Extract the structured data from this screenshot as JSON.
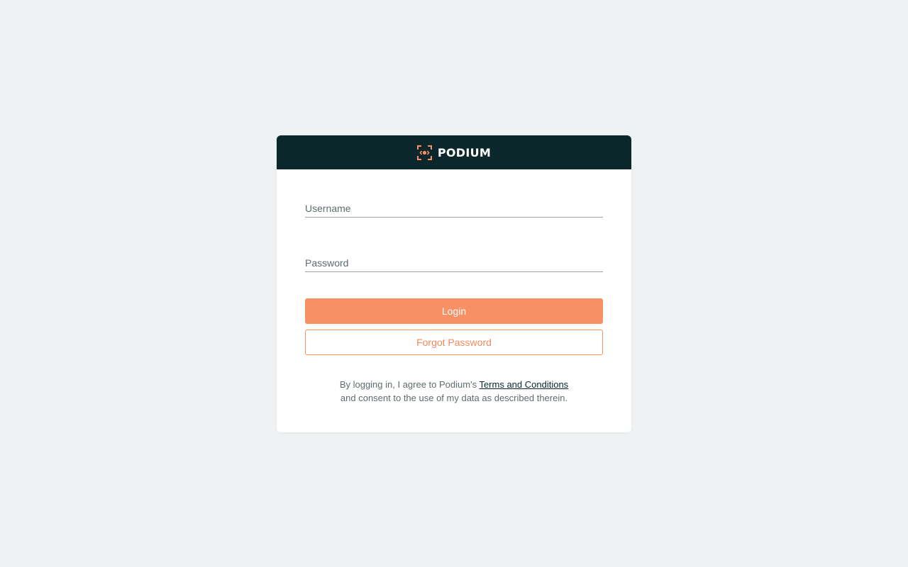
{
  "brand": {
    "name": "PODIUM",
    "logo_icon": "podium-logo-icon",
    "header_color": "#0b272c",
    "accent_color": "#f79065"
  },
  "form": {
    "username": {
      "placeholder": "Username",
      "value": ""
    },
    "password": {
      "placeholder": "Password",
      "value": ""
    },
    "login_label": "Login",
    "forgot_label": "Forgot Password"
  },
  "legal": {
    "prefix": "By logging in, I agree to Podium's ",
    "link_text": "Terms and Conditions",
    "suffix": "and consent to the use of my data as described therein."
  }
}
